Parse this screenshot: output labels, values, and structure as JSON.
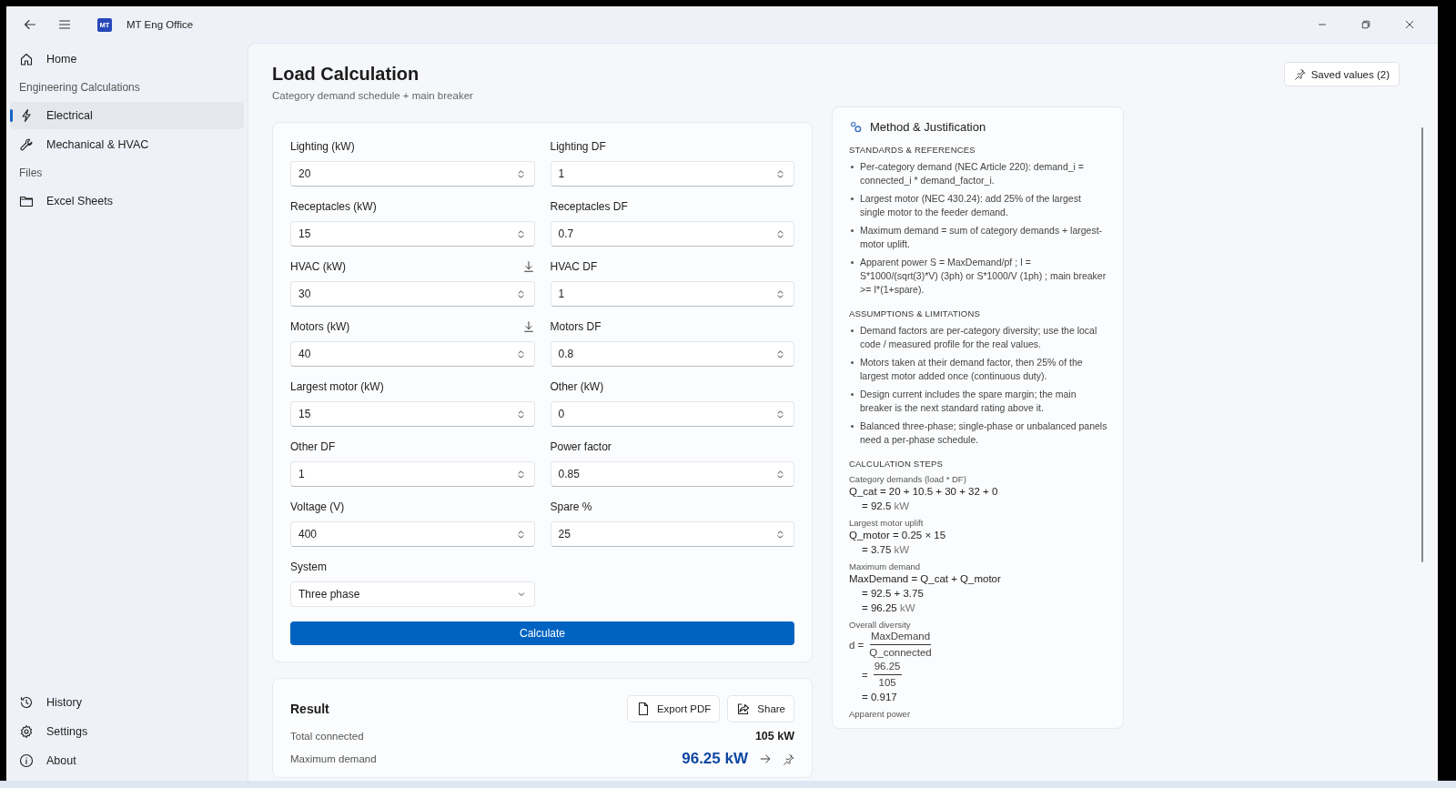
{
  "window": {
    "title": "MT Eng Office",
    "logo": "MT"
  },
  "sidebar": {
    "items": [
      {
        "kind": "item",
        "label": "Home",
        "selected": false
      },
      {
        "kind": "header",
        "label": "Engineering Calculations"
      },
      {
        "kind": "item",
        "label": "Electrical",
        "selected": true
      },
      {
        "kind": "item",
        "label": "Mechanical & HVAC",
        "selected": false
      },
      {
        "kind": "header",
        "label": "Files"
      },
      {
        "kind": "item",
        "label": "Excel Sheets",
        "selected": false
      }
    ],
    "footer_items": [
      {
        "label": "History",
        "selected": false
      },
      {
        "label": "Settings",
        "selected": false
      },
      {
        "label": "About",
        "selected": false
      }
    ]
  },
  "page": {
    "title": "Load Calculation",
    "subtitle": "Category demand schedule + main breaker",
    "saved_button": "Saved values (2)"
  },
  "form": {
    "fields": [
      {
        "label": "Lighting (kW)",
        "value": "20",
        "import_action": false
      },
      {
        "label": "Lighting DF",
        "value": "1",
        "import_action": false
      },
      {
        "label": "Receptacles (kW)",
        "value": "15",
        "import_action": false
      },
      {
        "label": "Receptacles DF",
        "value": "0.7",
        "import_action": false
      },
      {
        "label": "HVAC (kW)",
        "value": "30",
        "import_action": true
      },
      {
        "label": "HVAC DF",
        "value": "1",
        "import_action": false
      },
      {
        "label": "Motors (kW)",
        "value": "40",
        "import_action": true
      },
      {
        "label": "Motors DF",
        "value": "0.8",
        "import_action": false
      },
      {
        "label": "Largest motor (kW)",
        "value": "15",
        "import_action": false
      },
      {
        "label": "Other (kW)",
        "value": "0",
        "import_action": false
      },
      {
        "label": "Other DF",
        "value": "1",
        "import_action": false
      },
      {
        "label": "Power factor",
        "value": "0.85",
        "import_action": false
      },
      {
        "label": "Voltage (V)",
        "value": "400",
        "import_action": false
      },
      {
        "label": "Spare %",
        "value": "25",
        "import_action": false
      }
    ],
    "system": {
      "label": "System",
      "value": "Three phase"
    },
    "calculate_button": "Calculate"
  },
  "result": {
    "title": "Result",
    "buttons": [
      {
        "label": "Export PDF"
      },
      {
        "label": "Share"
      }
    ],
    "rows": [
      {
        "kind": "plain",
        "label": "Total connected",
        "value": "105 kW"
      },
      {
        "kind": "highlight",
        "label": "Maximum demand",
        "value": "96.25 kW"
      }
    ]
  },
  "method": {
    "title": "Method & Justification",
    "sections": [
      {
        "heading": "STANDARDS & REFERENCES",
        "bullets": [
          "Per-category demand (NEC Article 220):  demand_i = connected_i * demand_factor_i.",
          "Largest motor (NEC 430.24):  add 25% of the largest single motor to the feeder demand.",
          "Maximum demand = sum of category demands + largest-motor uplift.",
          "Apparent power S = MaxDemand/pf ;  I = S*1000/(sqrt(3)*V) (3ph) or S*1000/V (1ph) ;  main breaker >= I*(1+spare)."
        ]
      },
      {
        "heading": "ASSUMPTIONS & LIMITATIONS",
        "bullets": [
          "Demand factors are per-category diversity; use the local code / measured profile for the real values.",
          "Motors taken at their demand factor, then 25% of the largest motor added once (continuous duty).",
          "Design current includes the spare margin; the main breaker is the next standard rating above it.",
          "Balanced three-phase; single-phase or unbalanced panels need a per-phase schedule."
        ]
      }
    ],
    "steps_heading": "CALCULATION STEPS",
    "steps": [
      {
        "caption": "Category demands (load * DF)",
        "lines": [
          {
            "kind": "expr",
            "text": "Q_cat = 20 + 10.5 + 30 + 32 + 0"
          },
          {
            "kind": "cont",
            "text": "= 92.5",
            "unit": "kW"
          }
        ]
      },
      {
        "caption": "Largest motor uplift",
        "lines": [
          {
            "kind": "expr",
            "text": "Q_motor = 0.25 × 15"
          },
          {
            "kind": "cont",
            "text": "= 3.75",
            "unit": "kW"
          }
        ]
      },
      {
        "caption": "Maximum demand",
        "lines": [
          {
            "kind": "expr",
            "text": "MaxDemand = Q_cat + Q_motor"
          },
          {
            "kind": "cont",
            "text": "= 92.5 + 3.75"
          },
          {
            "kind": "cont",
            "text": "= 96.25",
            "unit": "kW"
          }
        ]
      },
      {
        "caption": "Overall diversity",
        "lines": [
          {
            "kind": "frac",
            "lhs": "d =",
            "num": "MaxDemand",
            "den": "Q_connected"
          },
          {
            "kind": "frac_cont",
            "lhs": "=",
            "num": "96.25",
            "den": "105"
          },
          {
            "kind": "cont",
            "text": "= 0.917"
          }
        ]
      },
      {
        "caption": "Apparent power"
      }
    ]
  }
}
